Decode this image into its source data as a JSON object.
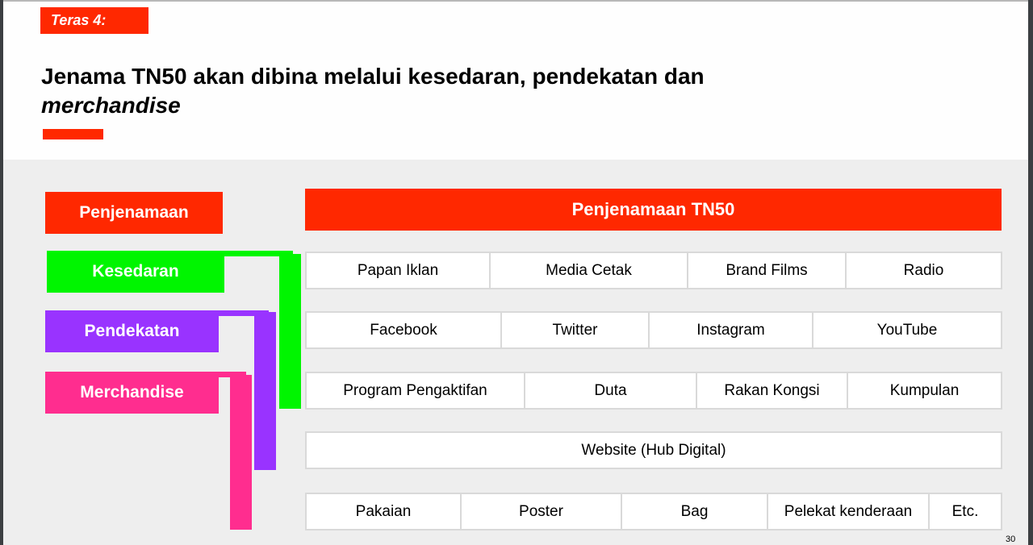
{
  "slide": {
    "tag": "Teras 4:",
    "title_line1": "Jenama TN50 akan dibina melalui kesedaran, pendekatan dan",
    "title_line2": "merchandise",
    "page_number": "30"
  },
  "categories": {
    "branding": {
      "label": "Penjenamaan",
      "color": "#ff2800"
    },
    "awareness": {
      "label": "Kesedaran",
      "color": "#00f500"
    },
    "approach": {
      "label": "Pendekatan",
      "color": "#9933ff"
    },
    "merchandise": {
      "label": "Merchandise",
      "color": "#ff2d8f"
    }
  },
  "banner": {
    "label": "Penjenamaan TN50"
  },
  "rows": [
    [
      "Papan Iklan",
      "Media Cetak",
      "Brand Films",
      "Radio"
    ],
    [
      "Facebook",
      "Twitter",
      "Instagram",
      "YouTube"
    ],
    [
      "Program Pengaktifan",
      "Duta",
      "Rakan Kongsi",
      "Kumpulan"
    ],
    [
      "Website (Hub Digital)"
    ],
    [
      "Pakaian",
      "Poster",
      "Bag",
      "Pelekat kenderaan",
      "Etc."
    ]
  ]
}
